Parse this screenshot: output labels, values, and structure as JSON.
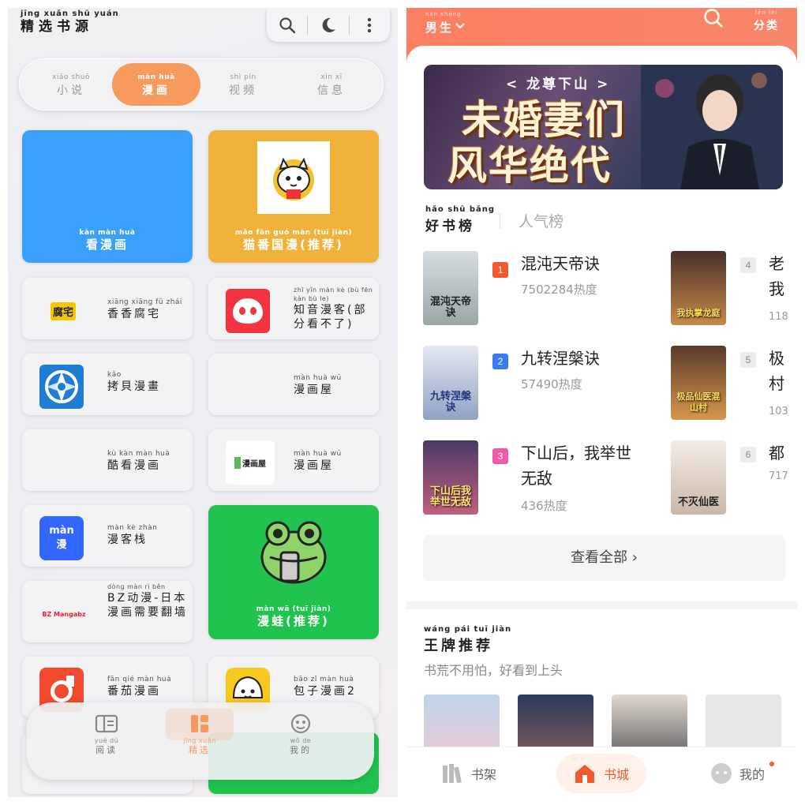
{
  "left": {
    "title": {
      "pinyin": "jīng xuǎn shū yuán",
      "text": "精选书源"
    },
    "toolbar": {
      "icons": [
        "search-icon",
        "moon-icon",
        "more-icon"
      ]
    },
    "tabs": [
      {
        "pinyin": "xiǎo shuō",
        "label": "小说"
      },
      {
        "pinyin": "màn huà",
        "label": "漫画"
      },
      {
        "pinyin": "shì pín",
        "label": "视频"
      },
      {
        "pinyin": "xìn xī",
        "label": "信息"
      }
    ],
    "sources": [
      {
        "pinyin": "kàn màn huà",
        "label": "看漫画"
      },
      {
        "pinyin": "māo fān guó màn (tuī jiàn)",
        "label": "猫番国漫(推荐)"
      },
      {
        "pinyin": "xiāng xiāng fǔ zhái",
        "label": "香香腐宅",
        "icon_text": "腐宅"
      },
      {
        "pinyin": "zhī yīn màn kè (bù fēn kàn bù le)",
        "label": "知音漫客(部分看不了)"
      },
      {
        "pinyin": "kǎo",
        "label": "拷貝漫畫"
      },
      {
        "pinyin": "màn huà wū",
        "label": "漫画屋"
      },
      {
        "pinyin": "kù kàn màn huà",
        "label": "酷看漫画"
      },
      {
        "pinyin": "màn huà wū",
        "label": "漫画屋",
        "icon_text": "漫画屋"
      },
      {
        "pinyin": "màn kè zhàn",
        "label": "漫客栈",
        "icon_text": "màn 漫"
      },
      {
        "pinyin": "màn wā (tuī jiàn)",
        "label": "漫蛙(推荐)"
      },
      {
        "pinyin": "dòng màn rì běn",
        "label": "BZ动漫-日本漫画需要翻墙",
        "icon_text": "BZ Mangabz"
      },
      {
        "pinyin": "fān qié màn huà",
        "label": "番茄漫画"
      },
      {
        "pinyin": "bāo zǐ màn huà",
        "label": "包子漫画2"
      }
    ],
    "nav": [
      {
        "pinyin": "yuè dú",
        "label": "阅读"
      },
      {
        "pinyin": "jīng xuǎn",
        "label": "精选"
      },
      {
        "pinyin": "wǒ de",
        "label": "我的"
      }
    ]
  },
  "right": {
    "header": {
      "gender_pinyin": "nán shēng",
      "gender": "男生",
      "category_pinyin": "fēn lèi",
      "category": "分类"
    },
    "banner": {
      "subtitle": "< 龙尊下山 >",
      "line1": "未婚妻们",
      "line2": "风华绝代"
    },
    "rank_tabs": [
      {
        "pinyin": "hǎo shū bǎng",
        "label": "好书榜"
      },
      {
        "label": "人气榜"
      }
    ],
    "books": [
      {
        "rank": "1",
        "title": "混沌天帝诀",
        "heat": "7502284热度",
        "cover_text": "混沌天帝诀"
      },
      {
        "rank": "2",
        "title": "九转涅槃诀",
        "heat": "57490热度",
        "cover_text": "九转涅槃诀"
      },
      {
        "rank": "3",
        "title": "下山后，我举世无敌",
        "heat": "436热度",
        "cover_text": "下山后我举世无敌"
      },
      {
        "rank": "4",
        "title": "老我",
        "heat": "118",
        "cover_text": "我执掌龙庭"
      },
      {
        "rank": "5",
        "title": "极村",
        "heat": "103",
        "cover_text": "极品仙医混山村"
      },
      {
        "rank": "6",
        "title": "都",
        "heat": "717",
        "cover_text": "不灭仙医"
      }
    ],
    "view_all": "查看全部 ›",
    "ace": {
      "pinyin": "wáng pái tuī jiàn",
      "title": "王牌推荐",
      "subtitle": "书荒不用怕，好看到上头"
    },
    "nav": [
      {
        "label": "书架"
      },
      {
        "label": "书城"
      },
      {
        "label": "我的"
      }
    ],
    "colors": {
      "accent": "#f25a2b",
      "header": "#fb7f63",
      "rank1": "#f25a2b",
      "rank2": "#3a7bf0",
      "rank3": "#f05aa8"
    }
  }
}
